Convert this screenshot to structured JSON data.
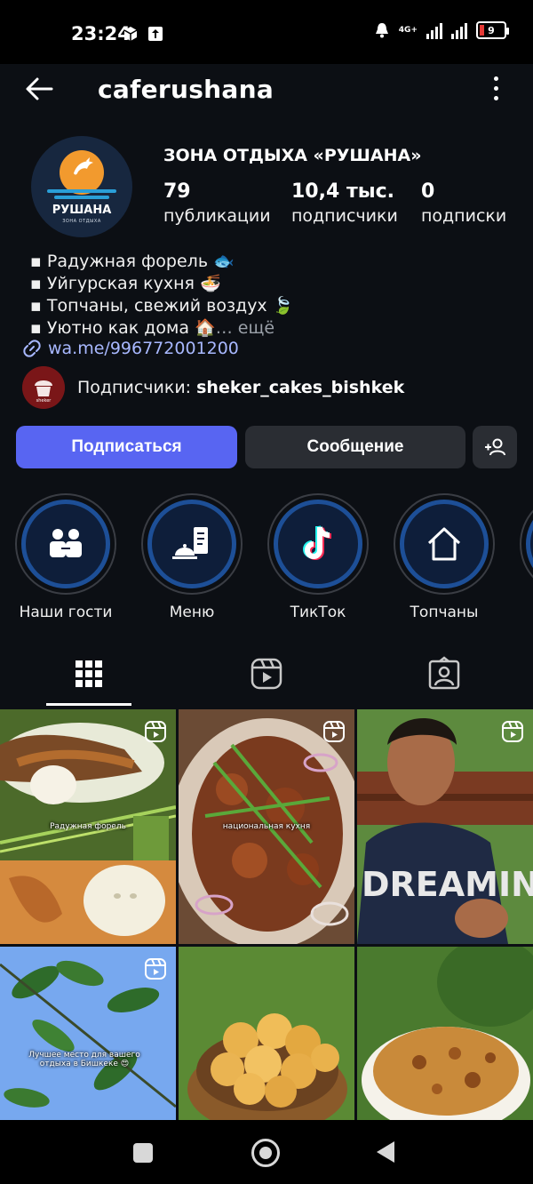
{
  "status_bar": {
    "time": "23:24",
    "network": "4G+",
    "battery": "9"
  },
  "header": {
    "username": "caferushana"
  },
  "profile": {
    "avatar_brand": "РУШАНА",
    "avatar_sub": "ЗОНА ОТДЫХА",
    "name": "ЗОНА ОТДЫХА «РУШАНА»",
    "stats": [
      {
        "value": "79",
        "label": "публикации"
      },
      {
        "value": "10,4 тыс.",
        "label": "подписчики"
      },
      {
        "value": "0",
        "label": "подписки"
      }
    ],
    "bio": [
      "▪ Радужная форель 🐟",
      "▪ Уйгурская кухня 🍜",
      "▪ Топчаны, свежий воздух 🍃",
      "▪ Уютно как дома 🏠"
    ],
    "bio_more": "… ещё",
    "link": "wa.me/996772001200",
    "followed_by_prefix": "Подписчики: ",
    "followed_by_user": "sheker_cakes_bishkek",
    "follower_avatar_text": "sheker"
  },
  "actions": {
    "follow": "Подписаться",
    "message": "Сообщение"
  },
  "highlights": [
    {
      "label": "Наши гости",
      "icon": "people-icon"
    },
    {
      "label": "Меню",
      "icon": "menu-cloche-icon"
    },
    {
      "label": "ТикТок",
      "icon": "tiktok-icon"
    },
    {
      "label": "Топчаны",
      "icon": "house-icon"
    }
  ],
  "tabs": [
    {
      "name": "grid",
      "icon": "grid-icon",
      "active": true
    },
    {
      "name": "reels",
      "icon": "reels-icon",
      "active": false
    },
    {
      "name": "tagged",
      "icon": "tagged-icon",
      "active": false
    }
  ],
  "posts": [
    {
      "caption": "Радужная форель"
    },
    {
      "caption": "национальная кухня"
    },
    {
      "caption": "DREAMIN"
    },
    {
      "caption": "Лучшее место для вашего отдыха в Бишкеке 😍"
    },
    {
      "caption": ""
    },
    {
      "caption": ""
    }
  ],
  "colors": {
    "accent": "#5865f2",
    "link": "#a8b8ff",
    "background": "#0c0f14",
    "secondary_button": "#2a2d33",
    "highlight_ring": "#1d4f97"
  }
}
